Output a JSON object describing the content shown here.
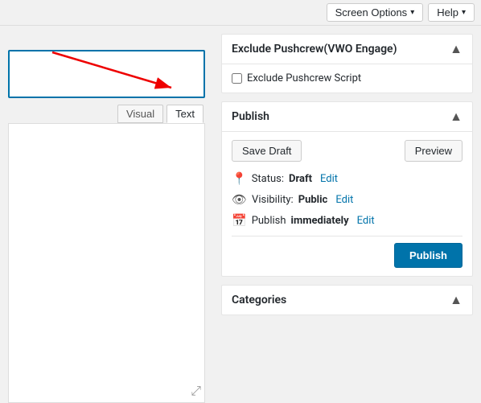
{
  "topbar": {
    "screen_options_label": "Screen Options",
    "help_label": "Help"
  },
  "editor": {
    "visual_tab": "Visual",
    "text_tab": "Text",
    "active_tab": "Text"
  },
  "exclude_pushcrew": {
    "title": "Exclude Pushcrew(VWO Engage)",
    "checkbox_label": "Exclude Pushcrew Script"
  },
  "publish": {
    "title": "Publish",
    "save_draft_label": "Save Draft",
    "preview_label": "Preview",
    "status_label": "Status:",
    "status_value": "Draft",
    "status_edit": "Edit",
    "visibility_label": "Visibility:",
    "visibility_value": "Public",
    "visibility_edit": "Edit",
    "publish_time_label": "Publish",
    "publish_time_value": "immediately",
    "publish_time_edit": "Edit",
    "publish_button": "Publish"
  },
  "categories": {
    "title": "Categories"
  }
}
